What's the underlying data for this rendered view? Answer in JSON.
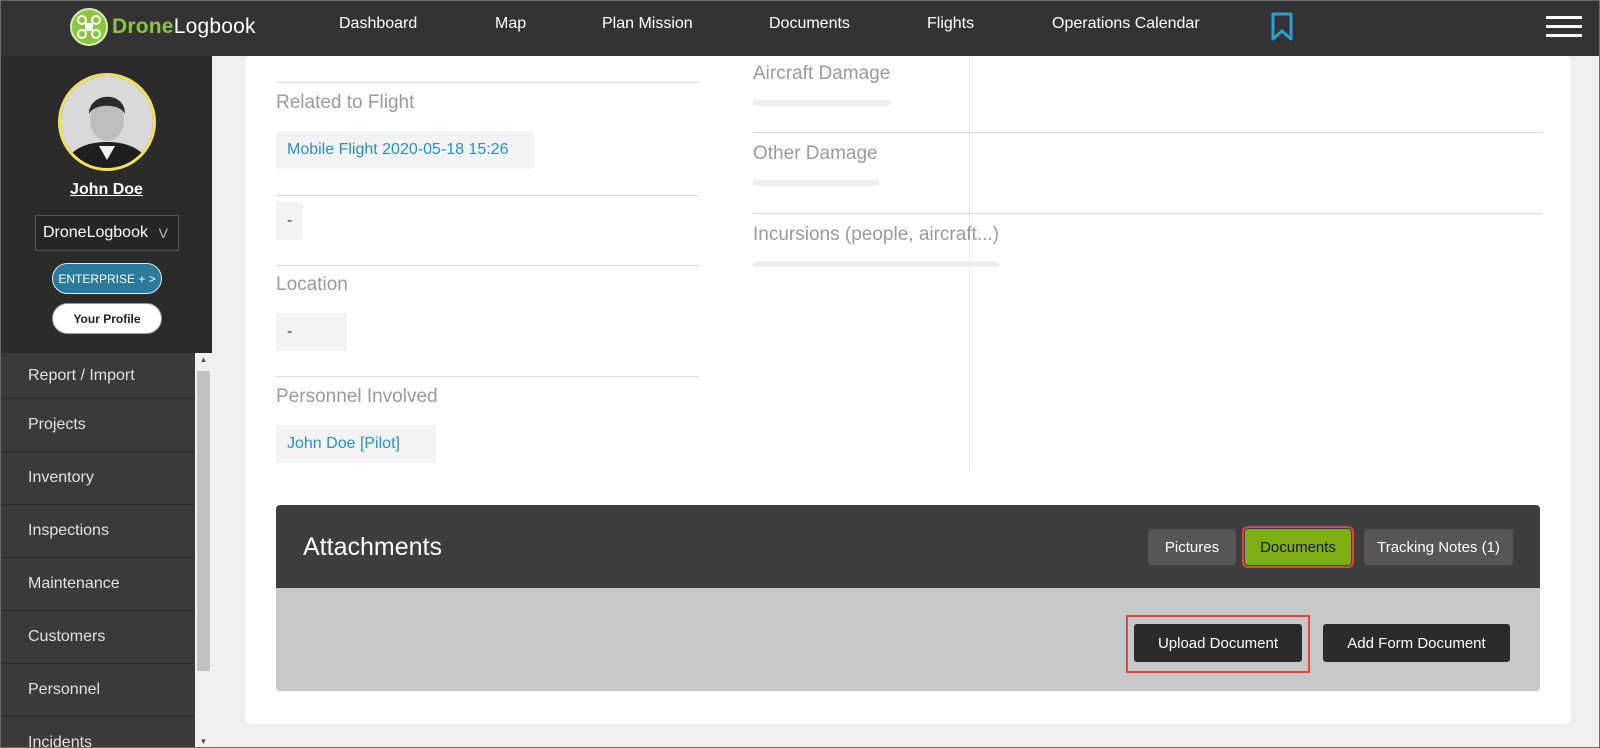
{
  "brand": {
    "word_bold": "Drone",
    "word_light": "Logbook"
  },
  "nav": {
    "items": [
      "Dashboard",
      "Map",
      "Plan Mission",
      "Documents",
      "Flights",
      "Operations Calendar"
    ],
    "bookmark_icon": "bookmark-icon",
    "menu_icon": "hamburger-menu-icon"
  },
  "sidebar": {
    "user_name": "John Doe",
    "org": "DroneLogbook",
    "org_chevron": "V",
    "plan_button": "ENTERPRISE + >",
    "profile_button": "Your Profile",
    "menu": [
      "Report / Import",
      "Projects",
      "Inventory",
      "Inspections",
      "Maintenance",
      "Customers",
      "Personnel",
      "Incidents"
    ]
  },
  "details": {
    "related_flight_label": "Related to Flight",
    "related_flight_value": "Mobile Flight 2020-05-18 15:26",
    "unnamed_value": "-",
    "location_label": "Location",
    "location_value": "-",
    "personnel_label": "Personnel Involved",
    "personnel_value": "John Doe [Pilot]",
    "aircraft_damage_label": "Aircraft Damage",
    "other_damage_label": "Other Damage",
    "incursions_label": "Incursions (people, aircraft...)"
  },
  "attachments": {
    "title": "Attachments",
    "tabs": {
      "pictures": "Pictures",
      "documents": "Documents",
      "tracking": "Tracking Notes (1)"
    },
    "active_tab": "Documents",
    "upload_button": "Upload Document",
    "form_button": "Add Form Document"
  },
  "colors": {
    "nav_bg": "#333333",
    "brand_green": "#8cc63f",
    "active_tab": "#7dae12",
    "link": "#2a8fc0",
    "highlight": "#e0453f",
    "enterprise": "#2a7a9c"
  }
}
